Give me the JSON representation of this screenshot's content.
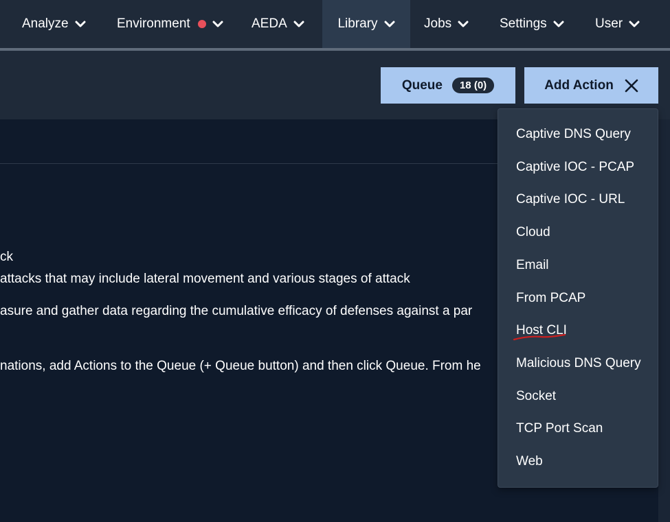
{
  "nav": {
    "items": [
      {
        "label": "Analyze"
      },
      {
        "label": "Environment"
      },
      {
        "label": "AEDA"
      },
      {
        "label": "Library"
      },
      {
        "label": "Jobs"
      },
      {
        "label": "Settings"
      },
      {
        "label": "User"
      }
    ],
    "active": "Library"
  },
  "toolbar": {
    "queue_label": "Queue",
    "queue_count": "18 (0)",
    "add_action_label": "Add Action"
  },
  "content": {
    "lines": [
      "ck",
      "attacks that may include lateral movement and various stages of attack",
      "asure and gather data regarding the cumulative efficacy of defenses against a par",
      "nations, add Actions to the Queue (+ Queue button) and then click Queue. From he"
    ]
  },
  "dropdown": {
    "items": [
      {
        "label": "Captive DNS Query"
      },
      {
        "label": "Captive IOC - PCAP"
      },
      {
        "label": "Captive IOC - URL"
      },
      {
        "label": "Cloud"
      },
      {
        "label": "Email"
      },
      {
        "label": "From PCAP"
      },
      {
        "label": "Host CLI"
      },
      {
        "label": "Malicious DNS Query"
      },
      {
        "label": "Socket"
      },
      {
        "label": "TCP Port Scan"
      },
      {
        "label": "Web"
      }
    ]
  },
  "colors": {
    "nav_bg": "#1f2a39",
    "page_bg": "#0f1a2b",
    "button_bg": "#a9c8f0",
    "status_dot": "#e8505b",
    "annotation": "#cc1f1f"
  },
  "icons": {
    "chevron": "chevron-down-icon",
    "close": "close-icon",
    "status": "status-dot-icon"
  }
}
